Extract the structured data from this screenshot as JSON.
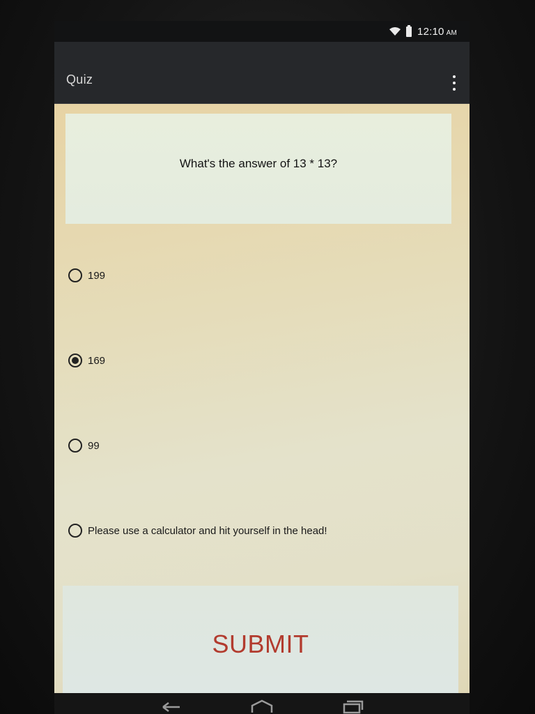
{
  "status_bar": {
    "time": "12:10",
    "ampm": "AM",
    "icons": [
      "wifi-icon",
      "battery-icon"
    ]
  },
  "action_bar": {
    "title": "Quiz",
    "overflow_icon": "more-vert-icon"
  },
  "question": {
    "text": "What's the answer of 13 * 13?"
  },
  "options": [
    {
      "label": "199",
      "checked": false
    },
    {
      "label": "169",
      "checked": true
    },
    {
      "label": "99",
      "checked": false
    },
    {
      "label": "Please use a calculator and hit yourself in the head!",
      "checked": false
    }
  ],
  "submit": {
    "label": "SUBMIT",
    "color": "#b23b2e"
  },
  "nav_bar": {
    "icons": [
      "back-icon",
      "home-icon",
      "recents-icon"
    ]
  }
}
